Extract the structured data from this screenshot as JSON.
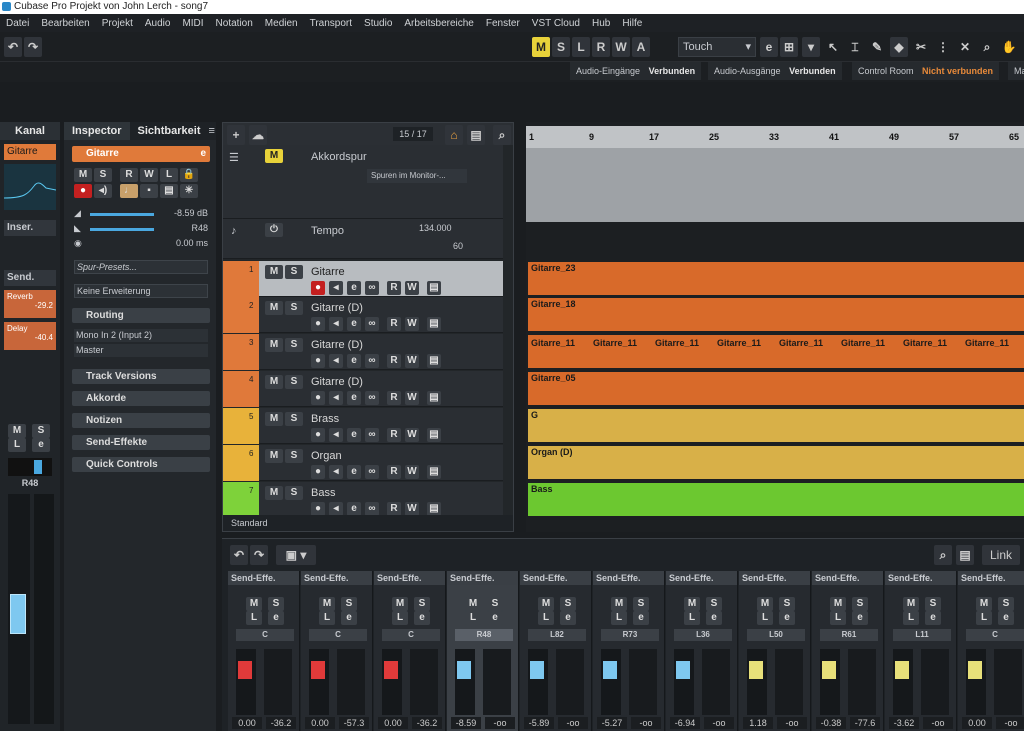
{
  "title": "Cubase Pro Projekt von John Lerch - song7",
  "menu": [
    "Datei",
    "Bearbeiten",
    "Projekt",
    "Audio",
    "MIDI",
    "Notation",
    "Medien",
    "Transport",
    "Studio",
    "Arbeitsbereiche",
    "Fenster",
    "VST Cloud",
    "Hub",
    "Hilfe"
  ],
  "toolbar": {
    "modes": [
      "M",
      "S",
      "L",
      "R",
      "W",
      "A"
    ],
    "automation_mode": "Touch"
  },
  "connections": [
    {
      "label": "Audio-Eingänge",
      "status": "Verbunden"
    },
    {
      "label": "Audio-Ausgänge",
      "status": "Verbunden"
    },
    {
      "label": "Control Room",
      "status": "Nicht verbunden"
    },
    {
      "label": "Ma",
      "status": ""
    }
  ],
  "left_strip": {
    "tab": "Kanal",
    "track": "Gitarre",
    "insert": "Inser.",
    "send": "Send.",
    "sends": [
      {
        "name": "Reverb",
        "value": "-29.2"
      },
      {
        "name": "Delay",
        "value": "-40.4"
      }
    ],
    "pan": "R48"
  },
  "inspector": {
    "tabs": [
      "Inspector",
      "Sichtbarkeit"
    ],
    "track": "Gitarre",
    "volume": "-8.59 dB",
    "pan": "R48",
    "delay": "0.00 ms",
    "presets_placeholder": "Spur-Presets...",
    "extension": "Keine Erweiterung",
    "routing": "Routing",
    "input": "Mono In 2 (Input 2)",
    "output": "Master",
    "sections": [
      "Track Versions",
      "Akkorde",
      "Notizen",
      "Send-Effekte",
      "Quick Controls"
    ]
  },
  "tracklist": {
    "counter": "15 / 17",
    "chord_track": "Akkordspur",
    "chord_monitor": "Spuren im Monitor-...",
    "tempo_track": "Tempo",
    "tempo_value": "134.000",
    "tempo_sig": "60",
    "tracks": [
      {
        "num": "1",
        "name": "Gitarre",
        "color": "#e0793a"
      },
      {
        "num": "2",
        "name": "Gitarre (D)",
        "color": "#e0793a"
      },
      {
        "num": "3",
        "name": "Gitarre (D)",
        "color": "#e0793a"
      },
      {
        "num": "4",
        "name": "Gitarre (D)",
        "color": "#e0793a"
      },
      {
        "num": "5",
        "name": "Brass",
        "color": "#e8b23a"
      },
      {
        "num": "6",
        "name": "Organ",
        "color": "#e8b23a"
      },
      {
        "num": "7",
        "name": "Bass",
        "color": "#7ed23a"
      }
    ],
    "footer": "Standard"
  },
  "ruler": [
    "1",
    "9",
    "17",
    "25",
    "33",
    "41",
    "49",
    "57",
    "65"
  ],
  "clips": [
    "Gitarre_23",
    "Gitarre_18",
    "Gitarre_11",
    "Gitarre_05",
    "G",
    "Organ (D)",
    "Bass"
  ],
  "clips_row3": [
    "Gitarre_11",
    "Gitarre_11",
    "Gitarre_11",
    "Gitarre_11",
    "Gitarre_11",
    "Gitarre_11",
    "Gitarre_11",
    "Gitarre_11"
  ],
  "mixer": {
    "link": "Link",
    "channels": [
      {
        "send": "Send-Effe.",
        "pan": "C",
        "vol": "0.00",
        "peak": "-36.2",
        "cap": "#e03a3a",
        "sel": false
      },
      {
        "send": "Send-Effe.",
        "pan": "C",
        "vol": "0.00",
        "peak": "-57.3",
        "cap": "#e03a3a",
        "sel": false
      },
      {
        "send": "Send-Effe.",
        "pan": "C",
        "vol": "0.00",
        "peak": "-36.2",
        "cap": "#e03a3a",
        "sel": false
      },
      {
        "send": "Send-Effe.",
        "pan": "R48",
        "vol": "-8.59",
        "peak": "-oo",
        "cap": "#7ec8f0",
        "sel": true
      },
      {
        "send": "Send-Effe.",
        "pan": "L82",
        "vol": "-5.89",
        "peak": "-oo",
        "cap": "#7ec8f0",
        "sel": false
      },
      {
        "send": "Send-Effe.",
        "pan": "R73",
        "vol": "-5.27",
        "peak": "-oo",
        "cap": "#7ec8f0",
        "sel": false
      },
      {
        "send": "Send-Effe.",
        "pan": "L36",
        "vol": "-6.94",
        "peak": "-oo",
        "cap": "#7ec8f0",
        "sel": false
      },
      {
        "send": "Send-Effe.",
        "pan": "L50",
        "vol": "1.18",
        "peak": "-oo",
        "cap": "#e8e07a",
        "sel": false
      },
      {
        "send": "Send-Effe.",
        "pan": "R61",
        "vol": "-0.38",
        "peak": "-77.6",
        "cap": "#e8e07a",
        "sel": false
      },
      {
        "send": "Send-Effe.",
        "pan": "L11",
        "vol": "-3.62",
        "peak": "-oo",
        "cap": "#e8e07a",
        "sel": false
      },
      {
        "send": "Send-Effe.",
        "pan": "C",
        "vol": "0.00",
        "peak": "-oo",
        "cap": "#e8e07a",
        "sel": false
      }
    ]
  }
}
